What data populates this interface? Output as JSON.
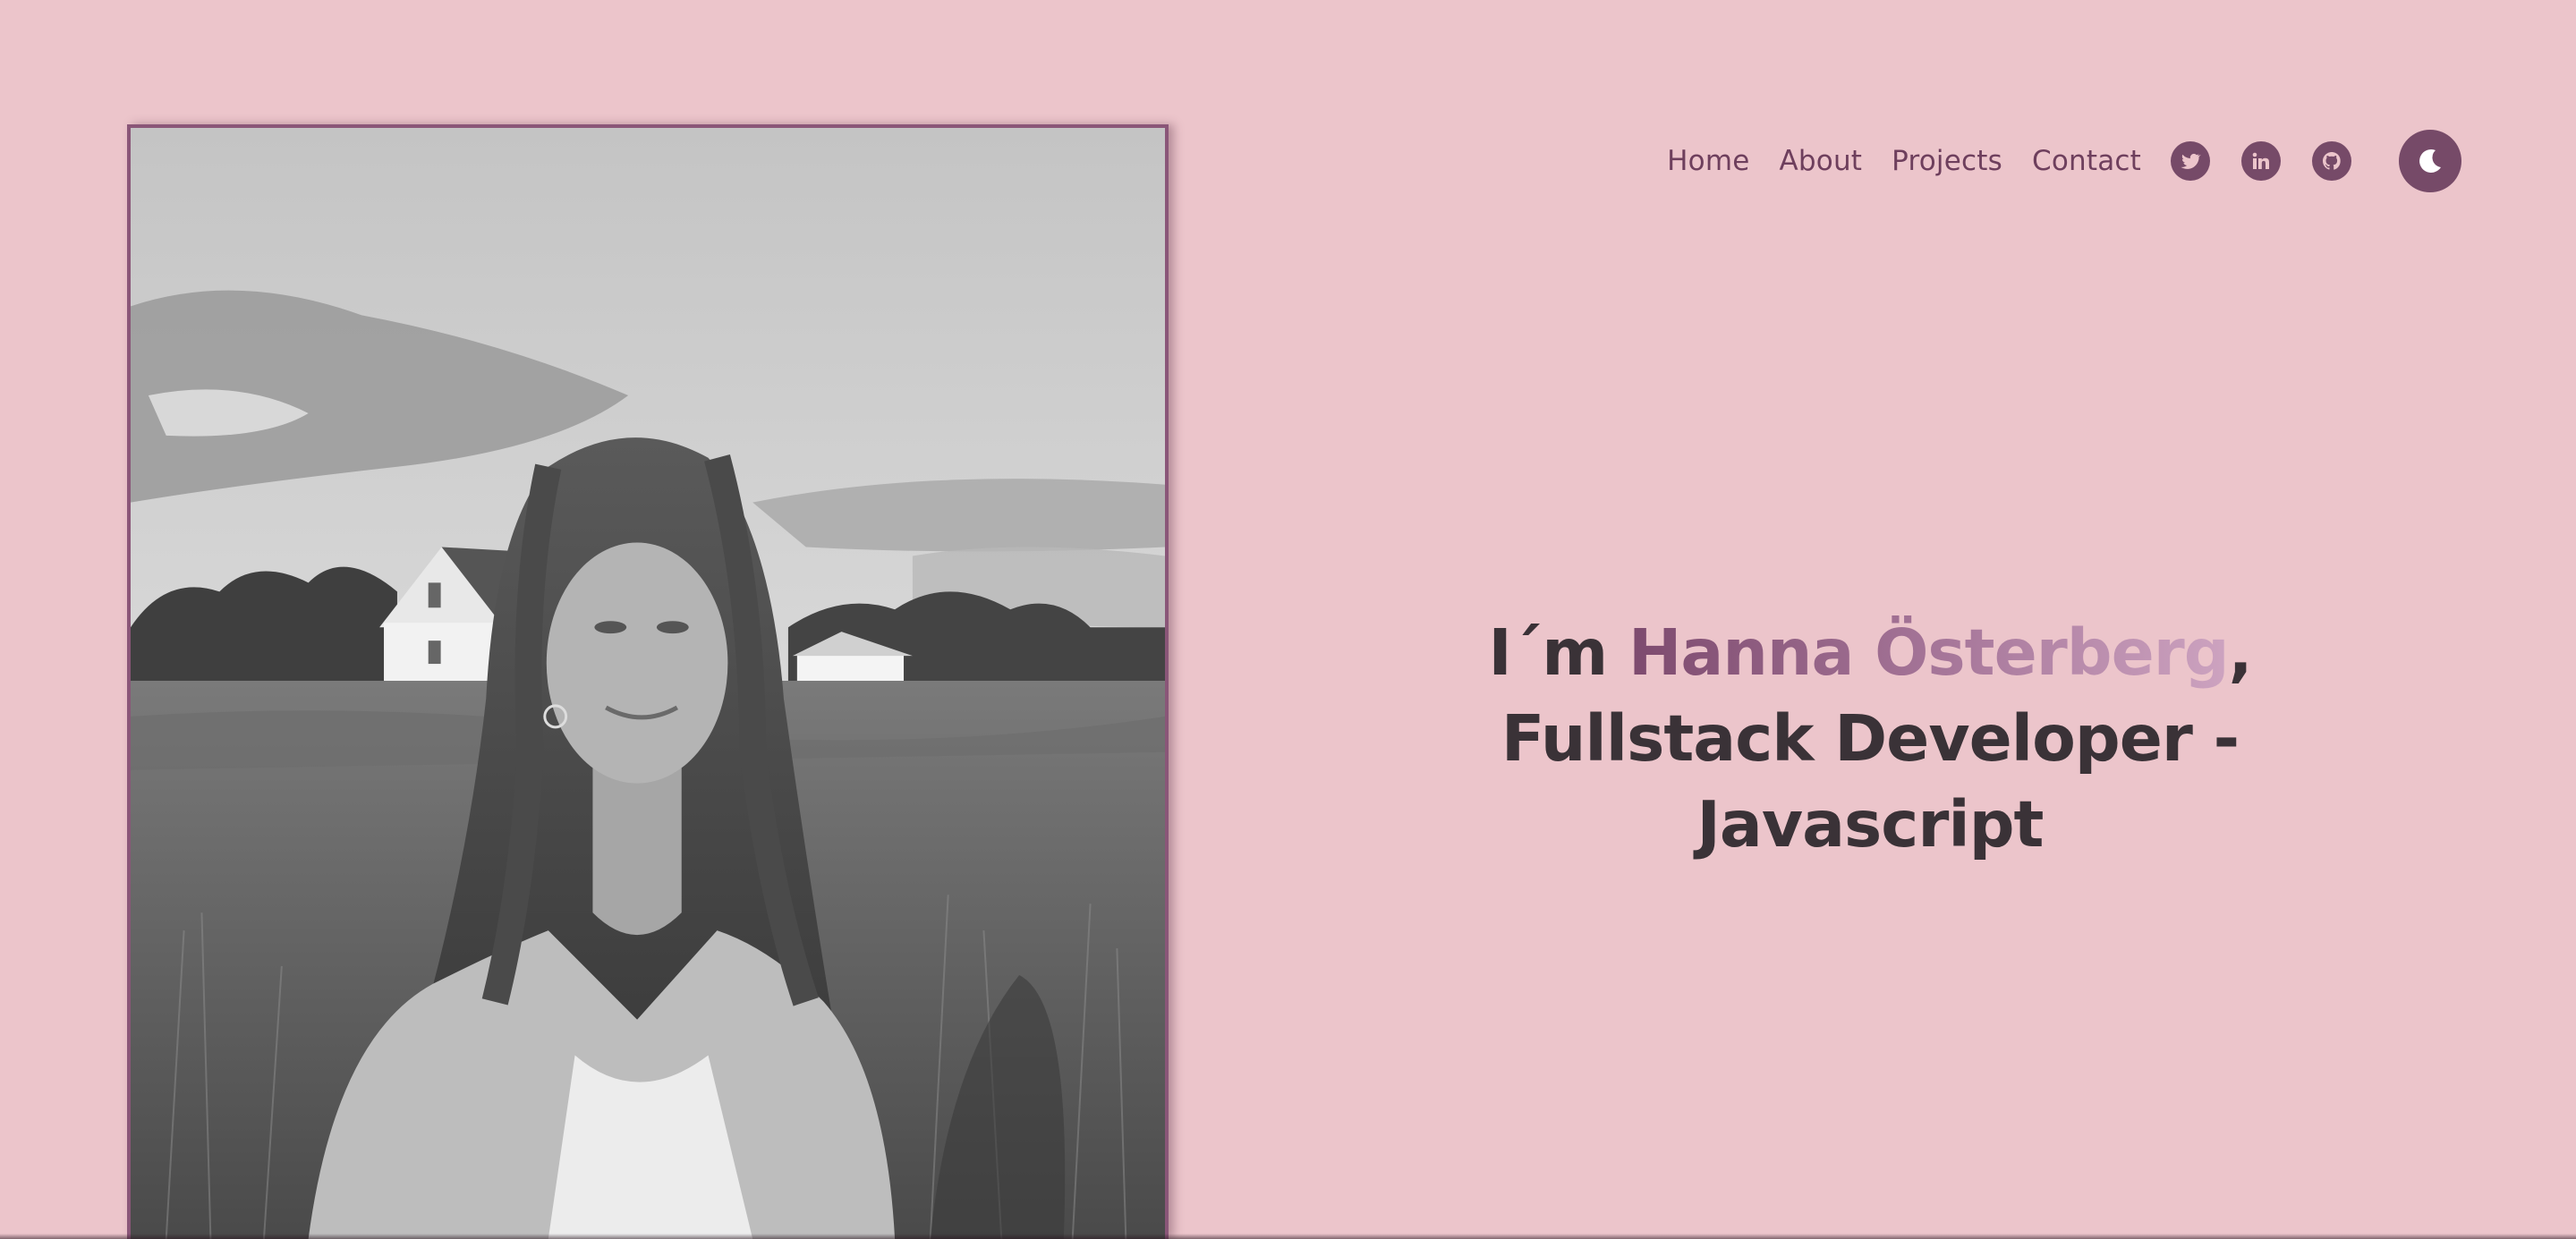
{
  "nav": {
    "links": [
      "Home",
      "About",
      "Projects",
      "Contact"
    ],
    "social_icons": [
      "twitter-icon",
      "linkedin-icon",
      "github-icon"
    ],
    "theme_icon": "moon-icon"
  },
  "hero": {
    "prefix": "I´m ",
    "name": "Hanna Österberg",
    "comma": ",",
    "subtitle": "Fullstack Developer - Javascript"
  },
  "colors": {
    "background": "#ecc5cb",
    "accent": "#764a68",
    "text": "#3a3237",
    "name_gradient_start": "#7d4a6e",
    "name_gradient_end": "#cda3c0"
  }
}
